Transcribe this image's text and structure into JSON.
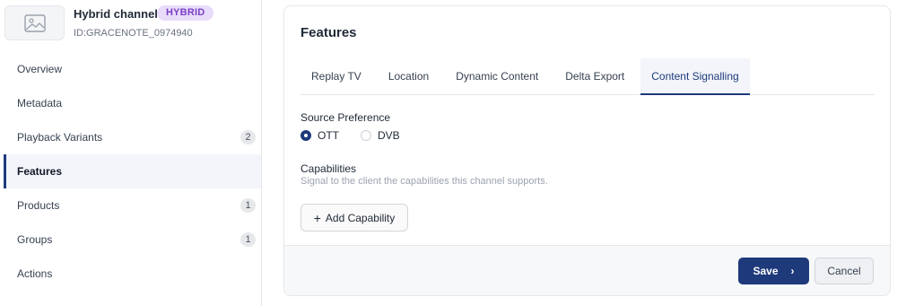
{
  "channel": {
    "name": "Hybrid channel",
    "badge": "HYBRID",
    "id": "ID:GRACENOTE_0974940",
    "thumbnail_icon": "image-placeholder-icon"
  },
  "sidebar": {
    "items": [
      {
        "label": "Overview",
        "count": null,
        "active": false
      },
      {
        "label": "Metadata",
        "count": null,
        "active": false
      },
      {
        "label": "Playback Variants",
        "count": "2",
        "active": false
      },
      {
        "label": "Features",
        "count": null,
        "active": true
      },
      {
        "label": "Products",
        "count": "1",
        "active": false
      },
      {
        "label": "Groups",
        "count": "1",
        "active": false
      },
      {
        "label": "Actions",
        "count": null,
        "active": false
      }
    ]
  },
  "main": {
    "title": "Features",
    "tabs": [
      {
        "label": "Replay TV",
        "active": false
      },
      {
        "label": "Location",
        "active": false
      },
      {
        "label": "Dynamic Content",
        "active": false
      },
      {
        "label": "Delta Export",
        "active": false
      },
      {
        "label": "Content Signalling",
        "active": true
      }
    ],
    "source_preference": {
      "label": "Source Preference",
      "options": [
        {
          "label": "OTT",
          "checked": true
        },
        {
          "label": "DVB",
          "checked": false
        }
      ]
    },
    "capabilities": {
      "label": "Capabilities",
      "description": "Signal to the client the capabilities this channel supports.",
      "add_button": "Add Capability"
    }
  },
  "footer": {
    "save_label": "Save",
    "cancel_label": "Cancel"
  },
  "colors": {
    "primary": "#1e3a7b",
    "badge_bg": "#e8dcfa",
    "badge_text": "#7b3fc6"
  }
}
